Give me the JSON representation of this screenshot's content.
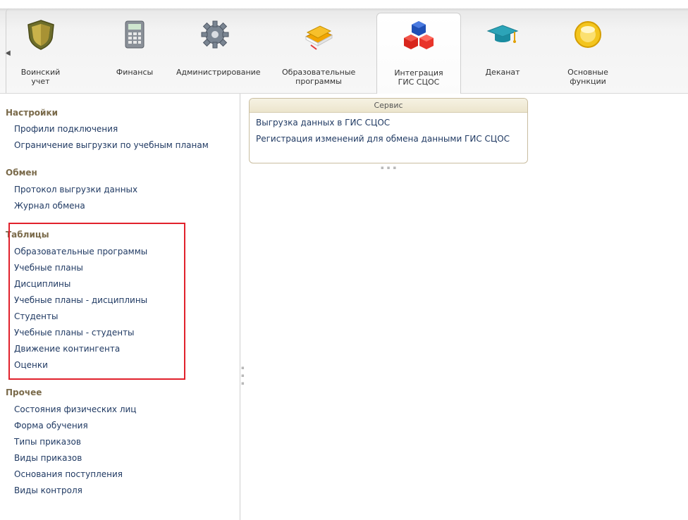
{
  "tabs": [
    {
      "label": "Воинский\nучет",
      "icon": "shield-icon"
    },
    {
      "label": "Финансы",
      "icon": "calculator-icon"
    },
    {
      "label": "Администрирование",
      "icon": "gear-icon"
    },
    {
      "label": "Образовательные\nпрограммы",
      "icon": "books-icon"
    },
    {
      "label": "Интеграция\nГИС СЦОС",
      "icon": "cubes-icon",
      "active": true
    },
    {
      "label": "Деканат",
      "icon": "graduation-cap-icon"
    },
    {
      "label": "Основные\nфункции",
      "icon": "yellow-circle-icon"
    }
  ],
  "sections": {
    "settings": {
      "title": "Настройки",
      "items": [
        "Профили подключения",
        "Ограничение выгрузки по учебным планам"
      ]
    },
    "exchange": {
      "title": "Обмен",
      "items": [
        "Протокол выгрузки данных",
        "Журнал обмена"
      ]
    },
    "tables": {
      "title": "Таблицы",
      "items": [
        "Образовательные программы",
        "Учебные планы",
        "Дисциплины",
        "Учебные планы - дисциплины",
        "Студенты",
        "Учебные планы - студенты",
        "Движение контингента",
        "Оценки"
      ]
    },
    "other": {
      "title": "Прочее",
      "items": [
        "Состояния физических лиц",
        "Форма обучения",
        "Типы приказов",
        "Виды приказов",
        "Основания поступления",
        "Виды контроля"
      ]
    }
  },
  "service": {
    "title": "Сервис",
    "items": [
      "Выгрузка данных в ГИС СЦОС",
      "Регистрация изменений для обмена данными ГИС СЦОС"
    ]
  },
  "colors": {
    "highlight": "#e1212c",
    "link": "#203a63",
    "section_title": "#7a6a4a"
  }
}
